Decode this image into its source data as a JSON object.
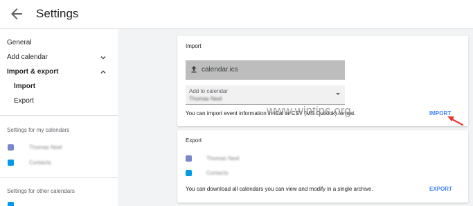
{
  "header": {
    "title": "Settings"
  },
  "sidebar": {
    "general": "General",
    "add_calendar": "Add calendar",
    "import_export": "Import & export",
    "import": "Import",
    "export": "Export",
    "my_calendars_heading": "Settings for my calendars",
    "my_calendars": [
      {
        "name": "Thomas Neel",
        "color": "#7986cb"
      },
      {
        "name": "Contacts",
        "color": "#039be5"
      }
    ],
    "other_calendars_heading": "Settings for other calendars"
  },
  "import_card": {
    "title": "Import",
    "file_name": "calendar.ics",
    "add_to_label": "Add to calendar",
    "add_to_value": "Thomas Neel",
    "description": "You can import event information in iCal or CSV (MS Outlook) format.",
    "action": "IMPORT"
  },
  "export_card": {
    "title": "Export",
    "calendars": [
      {
        "name": "Thomas Neel",
        "color": "#7986cb"
      },
      {
        "name": "Contacts",
        "color": "#039be5"
      }
    ],
    "description": "You can download all calendars you can view and modify in a single archive.",
    "action": "EXPORT"
  },
  "watermark": "www.wintips.org",
  "colors": {
    "accent": "#4285f4",
    "arrow": "#e53935"
  }
}
